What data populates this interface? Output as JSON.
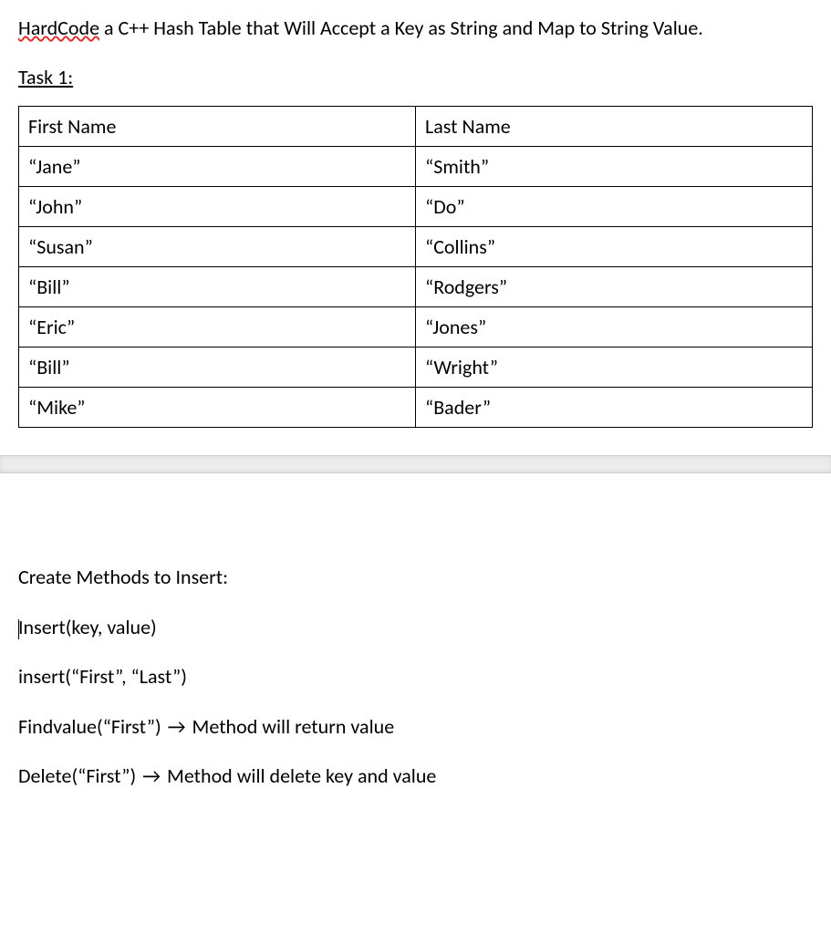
{
  "prompt": {
    "underlined_word": "HardCode",
    "rest": " a C++ Hash Table that Will Accept a Key as String and Map to String Value."
  },
  "task_label": "Task 1:",
  "table": {
    "header": {
      "col1": "First Name",
      "col2": "Last Name"
    },
    "rows": [
      {
        "first": "“Jane”",
        "last": "“Smith”"
      },
      {
        "first": "“John”",
        "last": "“Do”"
      },
      {
        "first": "“Susan”",
        "last": "“Collins”"
      },
      {
        "first": "“Bill”",
        "last": "“Rodgers”"
      },
      {
        "first": "“Eric”",
        "last": "“Jones”"
      },
      {
        "first": "“Bill”",
        "last": "“Wright”"
      },
      {
        "first": "“Mike”",
        "last": "“Bader”"
      }
    ]
  },
  "methods": {
    "heading": "Create Methods to Insert:",
    "line1": "nsert(key, value)",
    "line1_prefix": "I",
    "line2": "insert(“First”, “Last”)",
    "line3_left": "Findvalue(“First”) ",
    "line3_arrow": "→",
    "line3_right": " Method will return value",
    "line4_left": "Delete(“First”) ",
    "line4_arrow": "→",
    "line4_right": " Method will delete key and value"
  }
}
